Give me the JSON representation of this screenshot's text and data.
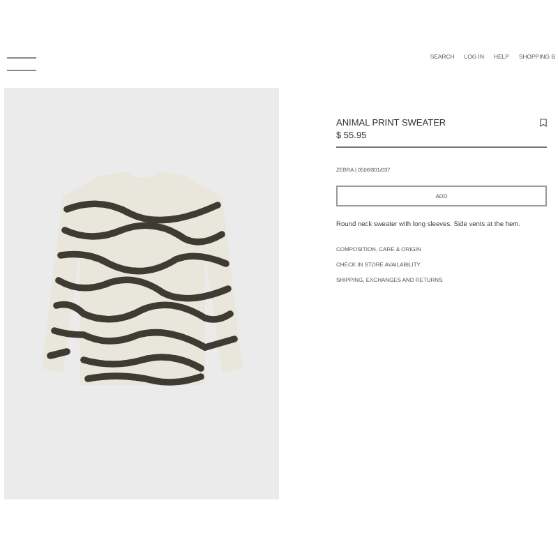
{
  "nav": {
    "links": [
      "SEARCH",
      "LOG IN",
      "HELP",
      "SHOPPING B"
    ]
  },
  "product": {
    "name": "ANIMAL PRINT SWEATER",
    "price": "$ 55.95",
    "bookmarked": false,
    "reference": "ZEBRA | 0506/801/037",
    "add_button": "ADD",
    "description": "Round neck sweater with long sleeves. Side vents at the hem.",
    "links": [
      "COMPOSITION, CARE & ORIGIN",
      "CHECK IN STORE AVAILABILITY",
      "SHIPPING, EXCHANGES AND RETURNS"
    ]
  }
}
